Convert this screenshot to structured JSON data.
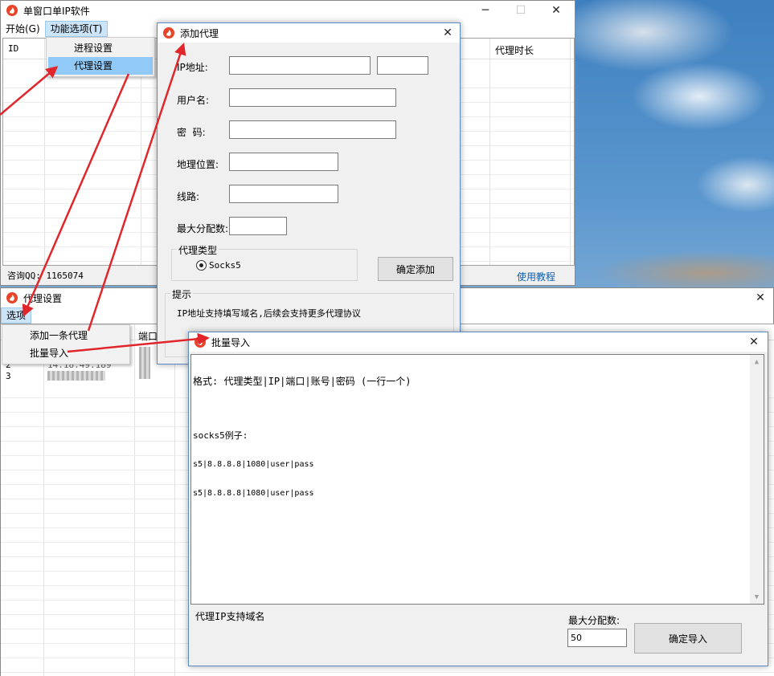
{
  "main_window": {
    "title": "单窗口单IP软件",
    "menu": [
      "开始(G)",
      "功能选项(T)"
    ],
    "menu_items": [
      "进程设置",
      "代理设置"
    ],
    "columns": [
      "ID",
      "代理时长"
    ],
    "status": "咨询QQ: 1165074",
    "tutorial_link": "使用教程"
  },
  "proxy_window": {
    "title": "代理设置",
    "menu": [
      "选项"
    ],
    "menu_items": [
      "添加一条代理",
      "批量导入"
    ],
    "column_port": "端口",
    "rows": [
      {
        "id": "2",
        "ip": "14.18.49.189"
      },
      {
        "id": "3",
        "ip": ""
      }
    ]
  },
  "add_proxy_dialog": {
    "title": "添加代理",
    "labels": {
      "ip": "IP地址:",
      "username": "用户名:",
      "password": "密  码:",
      "location": "地理位置:",
      "line": "线路:",
      "max_alloc": "最大分配数:"
    },
    "proxy_type_group": "代理类型",
    "proxy_type_option": "Socks5",
    "confirm_button": "确定添加",
    "tip_group": "提示",
    "tip_text": "IP地址支持填写域名,后续会支持更多代理协议"
  },
  "batch_import_dialog": {
    "title": "批量导入",
    "text_lines": [
      "格式: 代理类型|IP|端口|账号|密码 (一行一个)",
      "",
      "socks5例子:",
      "s5|8.8.8.8|1080|user|pass",
      "s5|8.8.8.8|1080|user|pass"
    ],
    "note": "代理IP支持域名",
    "max_alloc_label": "最大分配数:",
    "max_alloc_value": "50",
    "confirm_button": "确定导入"
  },
  "colors": {
    "arrow": "#e0262a",
    "highlight": "#91c9f7",
    "link": "#0a5fb4"
  },
  "icons": [
    "app-flame-icon",
    "close-icon",
    "minimize-icon",
    "maximize-icon",
    "radio-selected-icon",
    "scroll-up-icon",
    "scroll-down-icon"
  ]
}
